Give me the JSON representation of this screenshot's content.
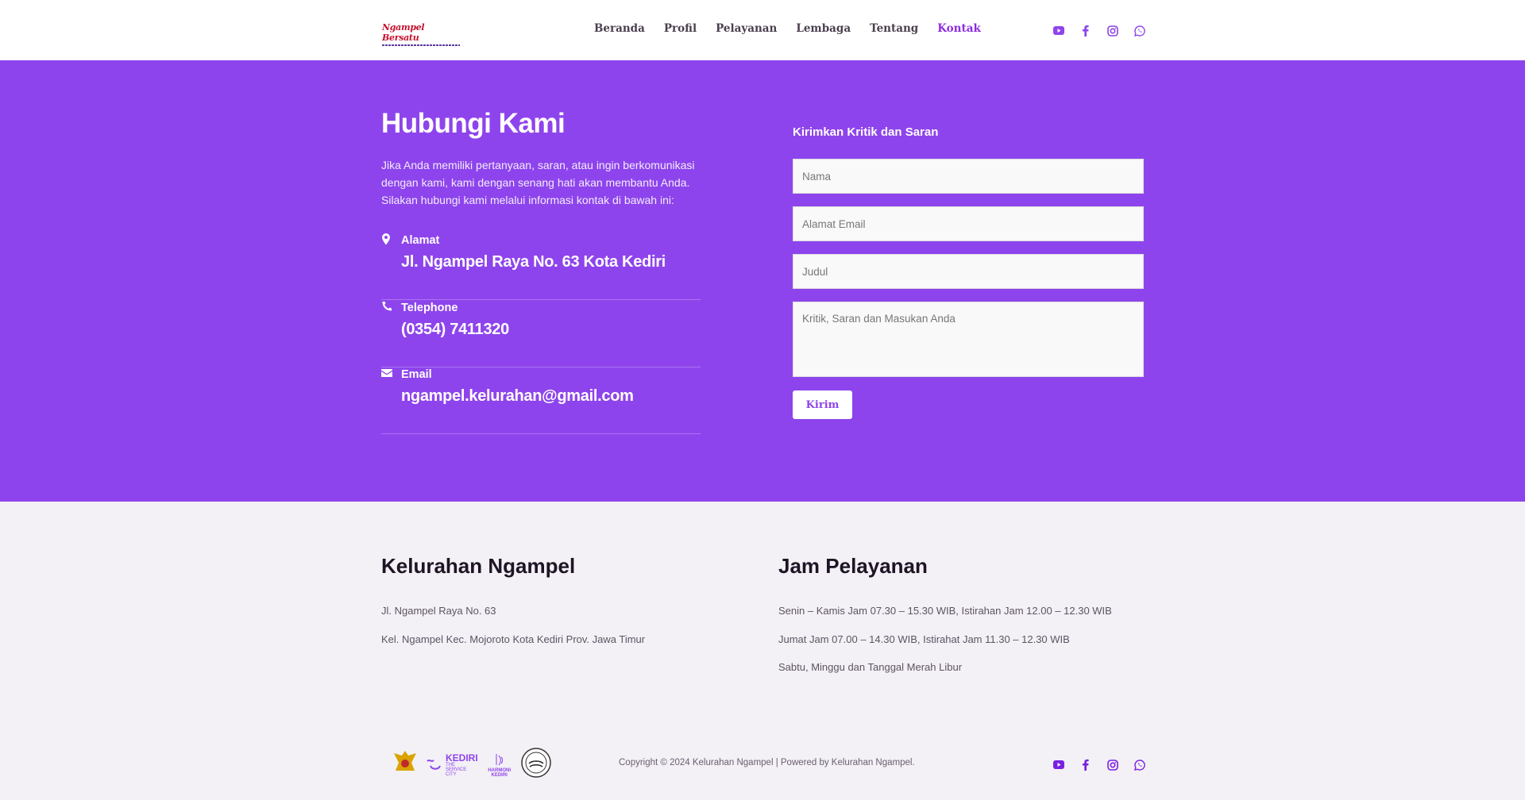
{
  "nav": {
    "logo_text": "Ngampel Bersatu",
    "items": [
      "Beranda",
      "Profil",
      "Pelayanan",
      "Lembaga",
      "Tentang",
      "Kontak"
    ],
    "active": "Kontak"
  },
  "social": [
    "youtube-icon",
    "facebook-icon",
    "instagram-icon",
    "whatsapp-icon"
  ],
  "contact": {
    "title": "Hubungi Kami",
    "intro": "Jika Anda memiliki pertanyaan, saran, atau ingin berkomunikasi dengan kami, kami dengan senang hati akan membantu Anda. Silakan hubungi kami melalui informasi kontak di bawah ini:",
    "items": [
      {
        "label": "Alamat",
        "value": "Jl. Ngampel Raya No. 63 Kota Kediri"
      },
      {
        "label": "Telephone",
        "value": "(0354) 7411320"
      },
      {
        "label": "Email",
        "value": "ngampel.kelurahan@gmail.com"
      }
    ]
  },
  "form": {
    "title": "Kirimkan Kritik dan Saran",
    "name_ph": "Nama",
    "email_ph": "Alamat Email",
    "subject_ph": "Judul",
    "message_ph": "Kritik, Saran dan Masukan Anda",
    "submit": "Kirim"
  },
  "footer": {
    "left_title": "Kelurahan Ngampel",
    "left_lines": [
      "Jl. Ngampel Raya No. 63",
      "Kel. Ngampel Kec. Mojoroto Kota Kediri Prov. Jawa Timur"
    ],
    "right_title": "Jam Pelayanan",
    "right_lines": [
      "Senin – Kamis Jam 07.30 – 15.30 WIB, Istirahan Jam 12.00 – 12.30 WIB",
      "Jumat Jam 07.00 – 14.30 WIB, Istirahat Jam 11.30 – 12.30 WIB",
      "Sabtu, Minggu dan Tanggal Merah Libur"
    ],
    "logos": {
      "kediri": "KEDIRI",
      "kediri_sub": "THE SERVICE CITY",
      "harmoni": "HARMONI KEDIRI"
    },
    "copyright": "Copyright © 2024 Kelurahan Ngampel | Powered by Kelurahan Ngampel."
  },
  "colors": {
    "primary": "#8e44ec",
    "footer_bg": "#f3f0f6"
  }
}
